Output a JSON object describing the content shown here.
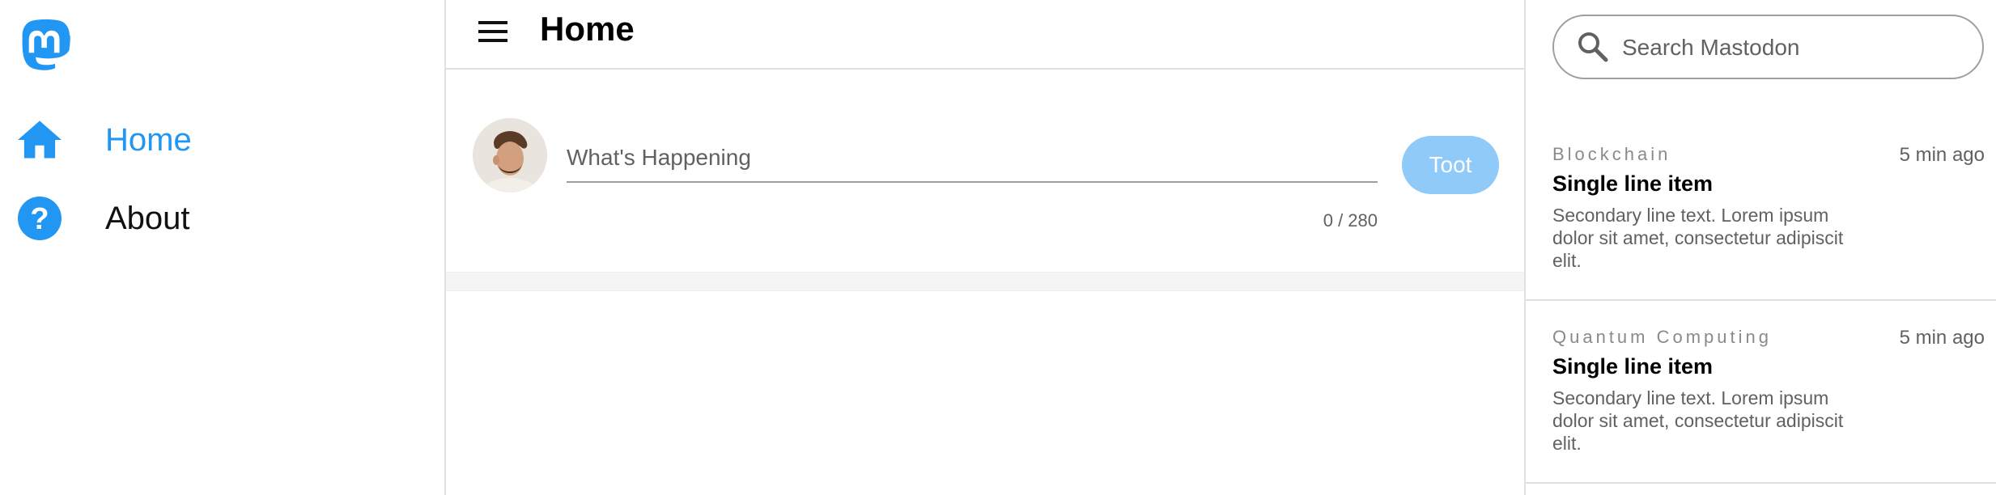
{
  "app": {
    "brand_color": "#2196f3"
  },
  "sidebar": {
    "logo_icon": "mastodon-logo",
    "items": [
      {
        "label": "Home",
        "icon": "home-icon",
        "active": true
      },
      {
        "label": "About",
        "icon": "help-circle-icon",
        "active": false
      }
    ]
  },
  "header": {
    "menu_icon": "menu-icon",
    "title": "Home"
  },
  "compose": {
    "placeholder": "What's Happening",
    "value": "",
    "char_count": "0 / 280",
    "submit_label": "Toot",
    "submit_enabled": false
  },
  "search": {
    "placeholder": "Search Mastodon",
    "icon": "search-icon"
  },
  "trends": [
    {
      "overline": "Blockchain",
      "time": "5 min ago",
      "primary": "Single line item",
      "secondary": "Secondary line text. Lorem ipsum dolor sit amet, consectetur adipiscit elit."
    },
    {
      "overline": "Quantum Computing",
      "time": "5 min ago",
      "primary": "Single line item",
      "secondary": "Secondary line text. Lorem ipsum dolor sit amet, consectetur adipiscit elit."
    }
  ]
}
